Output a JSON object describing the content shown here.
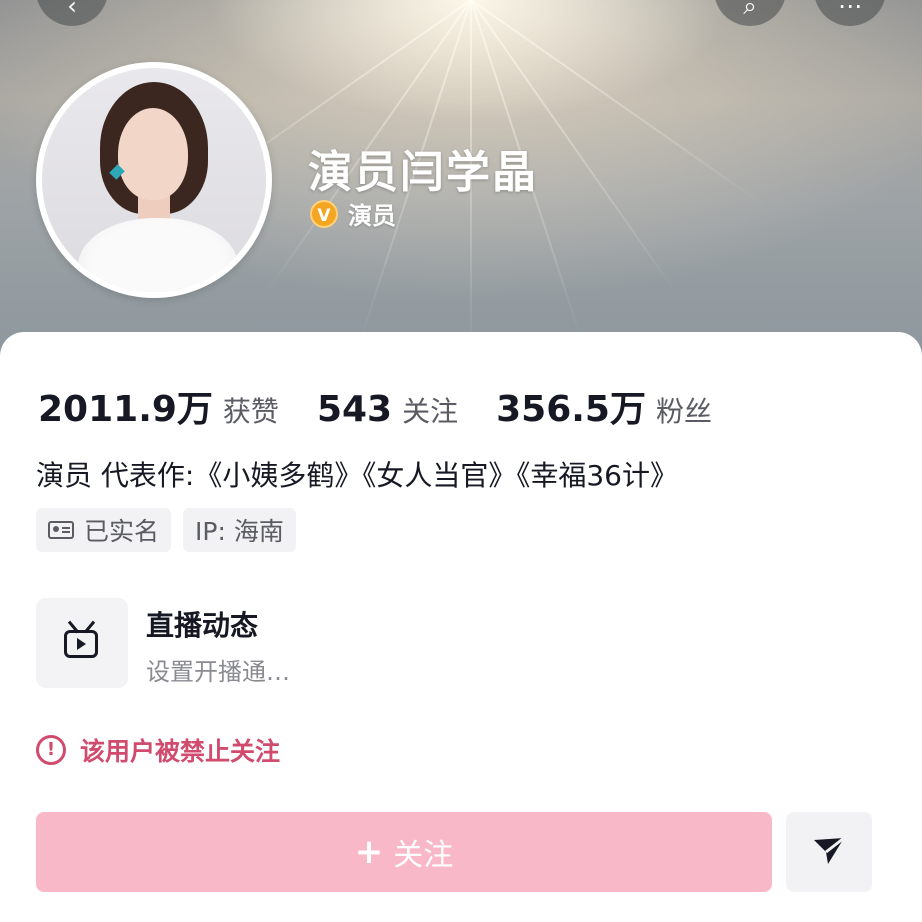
{
  "profile": {
    "name": "演员闫学晶",
    "verify_badge": "V",
    "verify_text": "演员",
    "bio": "演员 代表作:《小姨多鹤》《女人当官》《幸福36计》"
  },
  "stats": [
    {
      "value": "2011.9万",
      "label": "获赞"
    },
    {
      "value": "543",
      "label": "关注"
    },
    {
      "value": "356.5万",
      "label": "粉丝"
    }
  ],
  "tags": {
    "realname": "已实名",
    "ip": "IP: 海南"
  },
  "live": {
    "title": "直播动态",
    "subtitle": "设置开播通…"
  },
  "banned": {
    "icon": "!",
    "text": "该用户被禁止关注"
  },
  "actions": {
    "plus": "+",
    "follow_label": "关注"
  },
  "colors": {
    "follow_button": "#f9b8c8",
    "alert": "#d04b6e",
    "verify_badge": "#f4a623"
  }
}
